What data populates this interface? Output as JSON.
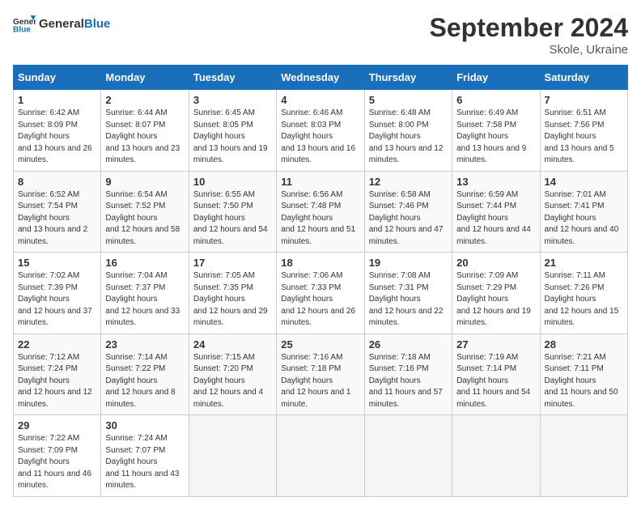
{
  "logo": {
    "text_general": "General",
    "text_blue": "Blue"
  },
  "title": "September 2024",
  "location": "Skole, Ukraine",
  "weekdays": [
    "Sunday",
    "Monday",
    "Tuesday",
    "Wednesday",
    "Thursday",
    "Friday",
    "Saturday"
  ],
  "weeks": [
    [
      {
        "num": "1",
        "sunrise": "6:42 AM",
        "sunset": "8:09 PM",
        "daylight": "13 hours and 26 minutes."
      },
      {
        "num": "2",
        "sunrise": "6:44 AM",
        "sunset": "8:07 PM",
        "daylight": "13 hours and 23 minutes."
      },
      {
        "num": "3",
        "sunrise": "6:45 AM",
        "sunset": "8:05 PM",
        "daylight": "13 hours and 19 minutes."
      },
      {
        "num": "4",
        "sunrise": "6:46 AM",
        "sunset": "8:03 PM",
        "daylight": "13 hours and 16 minutes."
      },
      {
        "num": "5",
        "sunrise": "6:48 AM",
        "sunset": "8:00 PM",
        "daylight": "13 hours and 12 minutes."
      },
      {
        "num": "6",
        "sunrise": "6:49 AM",
        "sunset": "7:58 PM",
        "daylight": "13 hours and 9 minutes."
      },
      {
        "num": "7",
        "sunrise": "6:51 AM",
        "sunset": "7:56 PM",
        "daylight": "13 hours and 5 minutes."
      }
    ],
    [
      {
        "num": "8",
        "sunrise": "6:52 AM",
        "sunset": "7:54 PM",
        "daylight": "13 hours and 2 minutes."
      },
      {
        "num": "9",
        "sunrise": "6:54 AM",
        "sunset": "7:52 PM",
        "daylight": "12 hours and 58 minutes."
      },
      {
        "num": "10",
        "sunrise": "6:55 AM",
        "sunset": "7:50 PM",
        "daylight": "12 hours and 54 minutes."
      },
      {
        "num": "11",
        "sunrise": "6:56 AM",
        "sunset": "7:48 PM",
        "daylight": "12 hours and 51 minutes."
      },
      {
        "num": "12",
        "sunrise": "6:58 AM",
        "sunset": "7:46 PM",
        "daylight": "12 hours and 47 minutes."
      },
      {
        "num": "13",
        "sunrise": "6:59 AM",
        "sunset": "7:44 PM",
        "daylight": "12 hours and 44 minutes."
      },
      {
        "num": "14",
        "sunrise": "7:01 AM",
        "sunset": "7:41 PM",
        "daylight": "12 hours and 40 minutes."
      }
    ],
    [
      {
        "num": "15",
        "sunrise": "7:02 AM",
        "sunset": "7:39 PM",
        "daylight": "12 hours and 37 minutes."
      },
      {
        "num": "16",
        "sunrise": "7:04 AM",
        "sunset": "7:37 PM",
        "daylight": "12 hours and 33 minutes."
      },
      {
        "num": "17",
        "sunrise": "7:05 AM",
        "sunset": "7:35 PM",
        "daylight": "12 hours and 29 minutes."
      },
      {
        "num": "18",
        "sunrise": "7:06 AM",
        "sunset": "7:33 PM",
        "daylight": "12 hours and 26 minutes."
      },
      {
        "num": "19",
        "sunrise": "7:08 AM",
        "sunset": "7:31 PM",
        "daylight": "12 hours and 22 minutes."
      },
      {
        "num": "20",
        "sunrise": "7:09 AM",
        "sunset": "7:29 PM",
        "daylight": "12 hours and 19 minutes."
      },
      {
        "num": "21",
        "sunrise": "7:11 AM",
        "sunset": "7:26 PM",
        "daylight": "12 hours and 15 minutes."
      }
    ],
    [
      {
        "num": "22",
        "sunrise": "7:12 AM",
        "sunset": "7:24 PM",
        "daylight": "12 hours and 12 minutes."
      },
      {
        "num": "23",
        "sunrise": "7:14 AM",
        "sunset": "7:22 PM",
        "daylight": "12 hours and 8 minutes."
      },
      {
        "num": "24",
        "sunrise": "7:15 AM",
        "sunset": "7:20 PM",
        "daylight": "12 hours and 4 minutes."
      },
      {
        "num": "25",
        "sunrise": "7:16 AM",
        "sunset": "7:18 PM",
        "daylight": "12 hours and 1 minute."
      },
      {
        "num": "26",
        "sunrise": "7:18 AM",
        "sunset": "7:16 PM",
        "daylight": "11 hours and 57 minutes."
      },
      {
        "num": "27",
        "sunrise": "7:19 AM",
        "sunset": "7:14 PM",
        "daylight": "11 hours and 54 minutes."
      },
      {
        "num": "28",
        "sunrise": "7:21 AM",
        "sunset": "7:11 PM",
        "daylight": "11 hours and 50 minutes."
      }
    ],
    [
      {
        "num": "29",
        "sunrise": "7:22 AM",
        "sunset": "7:09 PM",
        "daylight": "11 hours and 46 minutes."
      },
      {
        "num": "30",
        "sunrise": "7:24 AM",
        "sunset": "7:07 PM",
        "daylight": "11 hours and 43 minutes."
      },
      null,
      null,
      null,
      null,
      null
    ]
  ]
}
